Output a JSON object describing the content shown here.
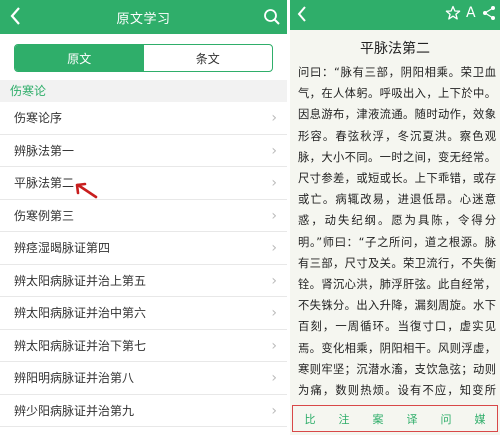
{
  "left": {
    "header_title": "原文学习",
    "segment": {
      "active": "原文",
      "inactive": "条文"
    },
    "section": "伤寒论",
    "chapters": [
      "伤寒论序",
      "辨脉法第一",
      "平脉法第二",
      "伤寒例第三",
      "辨痉湿暍脉证第四",
      "辨太阳病脉证并治上第五",
      "辨太阳病脉证并治中第六",
      "辨太阳病脉证并治下第七",
      "辨阳明病脉证并治第八",
      "辨少阳病脉证并治第九"
    ]
  },
  "right": {
    "font_label": "A",
    "title": "平脉法第二",
    "body": "问曰：“脉有三部，阴阳相乘。荣卫血气，在人体躬。呼吸出入，上下於中。因息游布，津液流通。随时动作，效象形容。春弦秋浮，冬沉夏洪。察色观脉，大小不同。一时之间，变无经常。尺寸参差，或短或长。上下乖错，或存或亡。病辄改易，进退低昂。心迷意惑，动失纪纲。愿为具陈，令得分明。”师曰：“子之所问，道之根源。脉有三部，尺寸及关。荣卫流行，不失衡铨。肾沉心洪，肺浮肝弦。此自经常，不失铢分。出入升降，漏刻周旋。水下百刻，一周循环。当復寸口，虚实见焉。变化相乘，阴阳相干。风则浮虚，寒则牢坚；沉潜水滀，支饮急弦；动则为痛，数则热烦。设有不应，知变所缘。三部不同，病各异端。太过可怪，不及亦然。邪不空见，终必有奸。审察表里，三焦别焉。知其所舍，消息诊看。料",
    "toolbar": [
      "比",
      "注",
      "案",
      "译",
      "问",
      "媒"
    ]
  },
  "colors": {
    "accent": "#2fae6a",
    "highlight_border": "#d84848",
    "annotation_arrow": "#c81e1e"
  }
}
